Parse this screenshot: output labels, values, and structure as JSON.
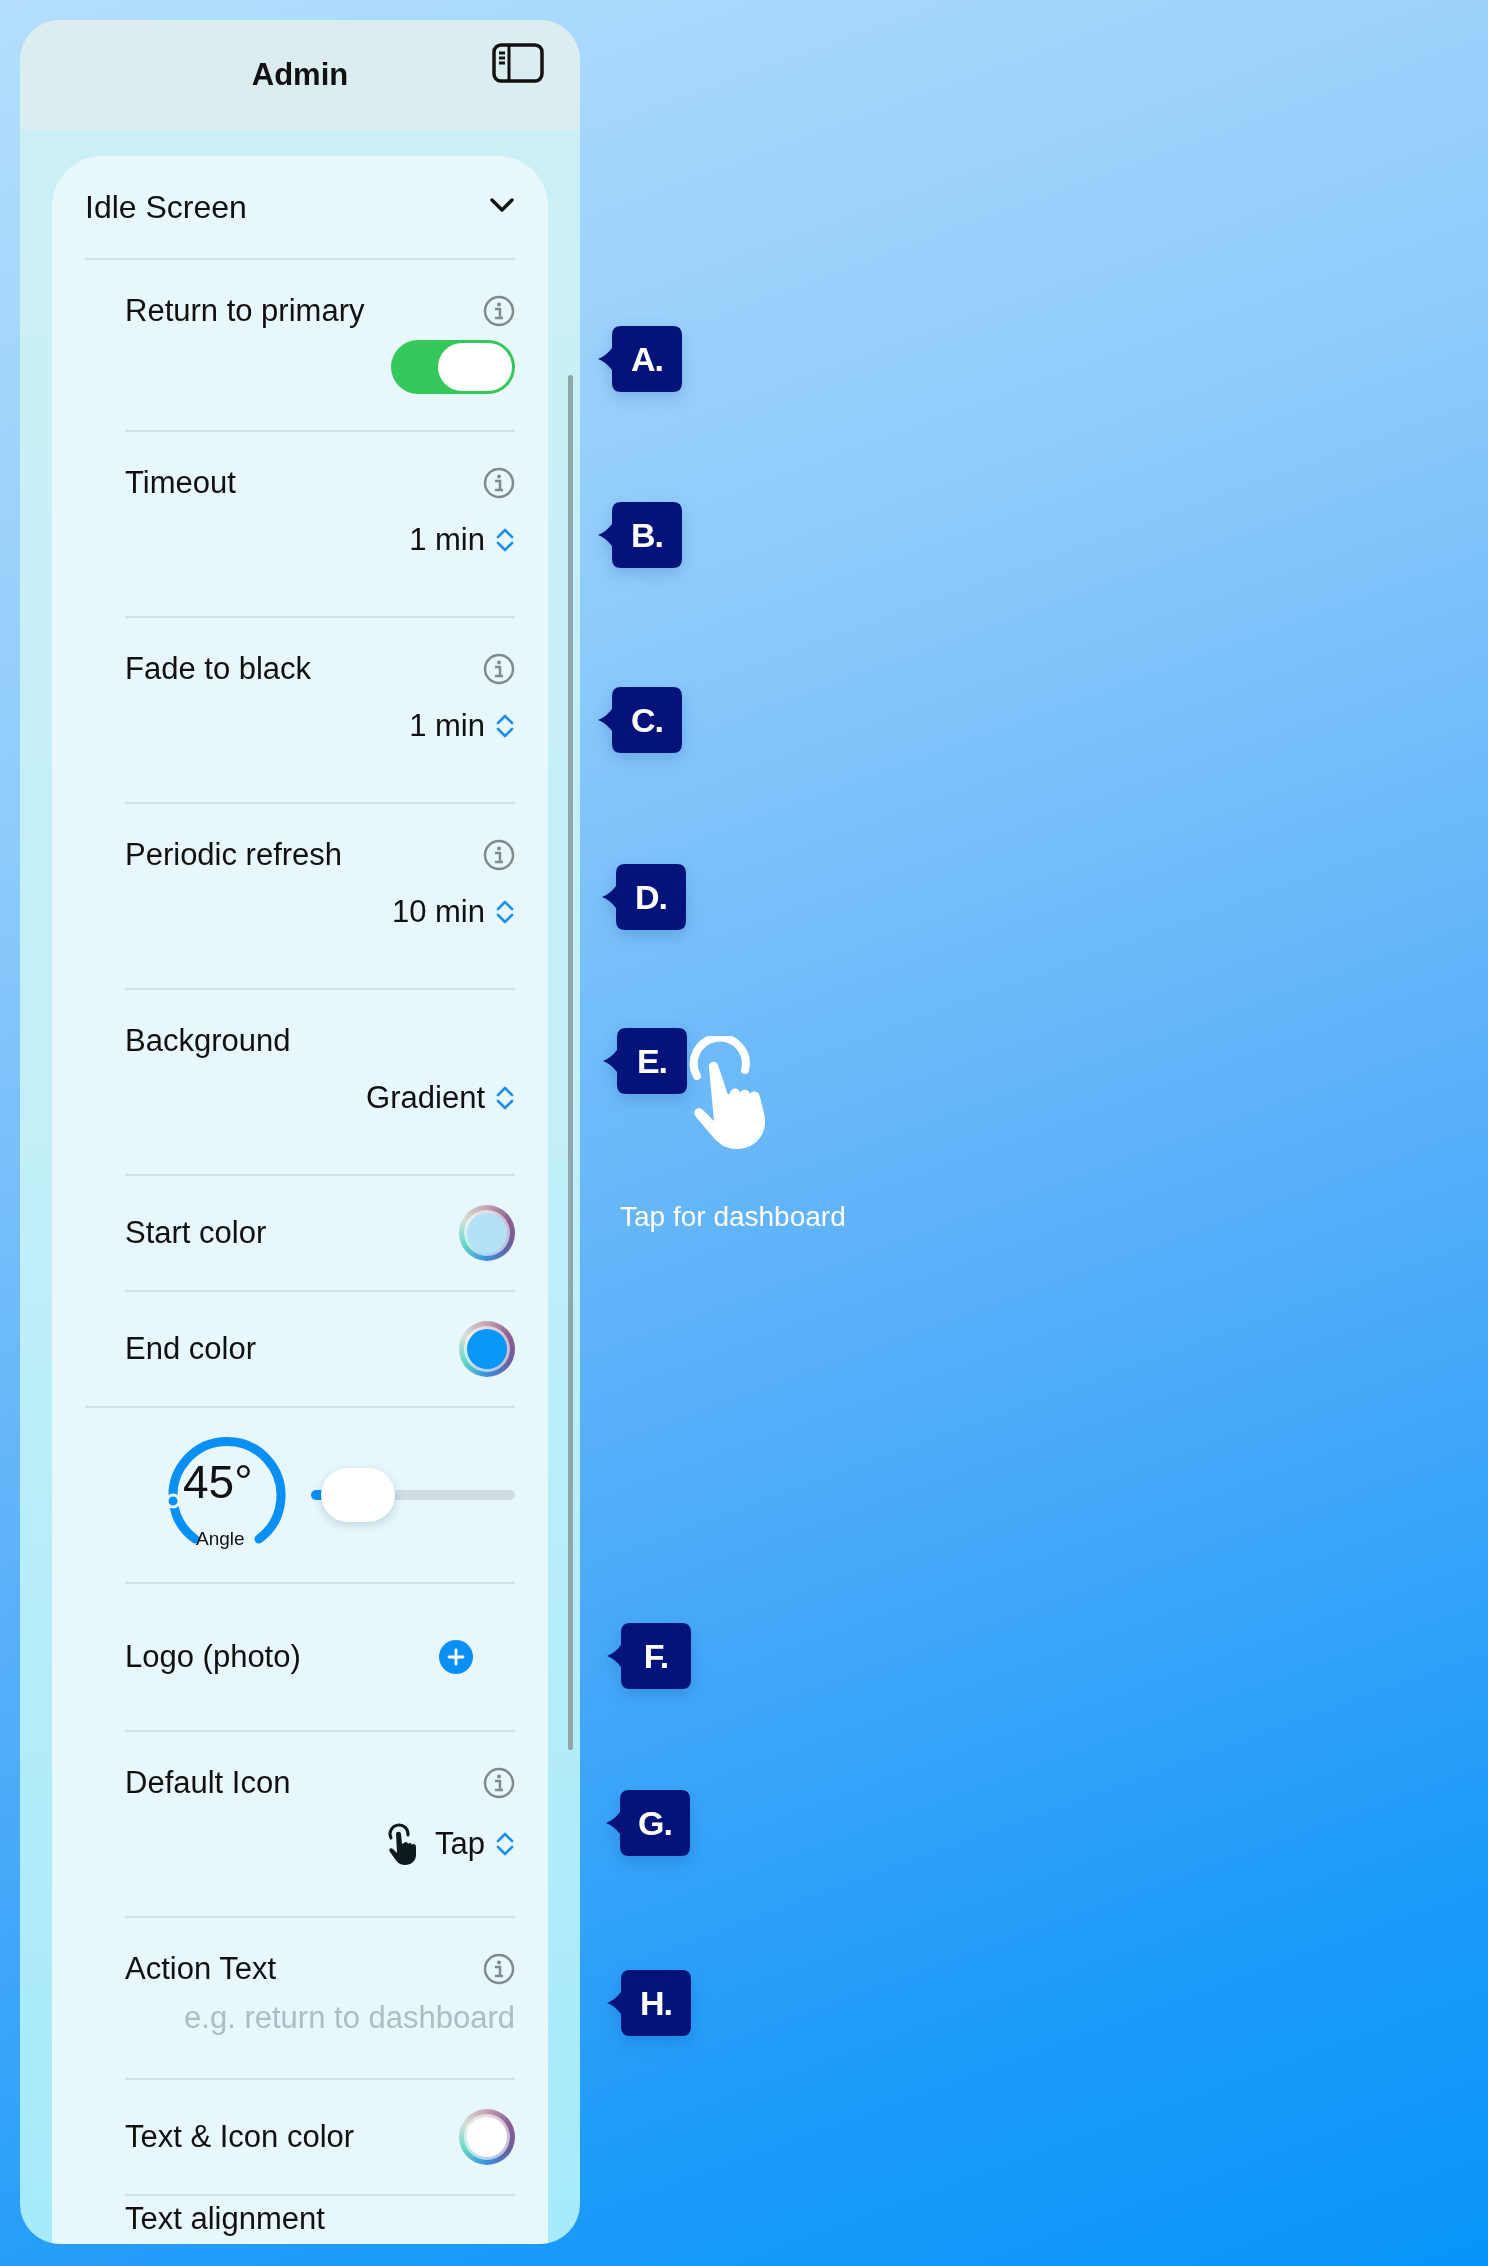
{
  "header": {
    "title": "Admin"
  },
  "section": {
    "title": "Idle Screen",
    "expanded": true,
    "rows": [
      {
        "kind": "toggle",
        "label": "Return to primary",
        "info": true,
        "on": true
      },
      {
        "kind": "picker",
        "label": "Timeout",
        "info": true,
        "value": "1 min"
      },
      {
        "kind": "picker",
        "label": "Fade to black",
        "info": true,
        "value": "1 min"
      },
      {
        "kind": "picker",
        "label": "Periodic refresh",
        "info": true,
        "value": "10 min"
      },
      {
        "kind": "picker",
        "label": "Background",
        "info": false,
        "value": "Gradient"
      },
      {
        "kind": "color",
        "label": "Start color",
        "color": "#b3e1f8"
      },
      {
        "kind": "color",
        "label": "End color",
        "color": "#0a96f6"
      },
      {
        "kind": "angle",
        "value": "45°",
        "caption": "Angle",
        "level": 0.23
      },
      {
        "kind": "add",
        "label": "Logo (photo)"
      },
      {
        "kind": "icon_picker",
        "label": "Default Icon",
        "info": true,
        "value": "Tap"
      },
      {
        "kind": "text",
        "label": "Action Text",
        "info": true,
        "placeholder": "e.g. return to dashboard"
      },
      {
        "kind": "color",
        "label": "Text & Icon color",
        "color": "#ffffff"
      },
      {
        "kind": "plain",
        "label": "Text alignment"
      }
    ]
  },
  "callouts": [
    {
      "label": "A."
    },
    {
      "label": "B."
    },
    {
      "label": "C."
    },
    {
      "label": "D."
    },
    {
      "label": "E."
    },
    {
      "label": "F."
    },
    {
      "label": "G."
    },
    {
      "label": "H."
    }
  ],
  "hint": {
    "text": "Tap for dashboard"
  }
}
